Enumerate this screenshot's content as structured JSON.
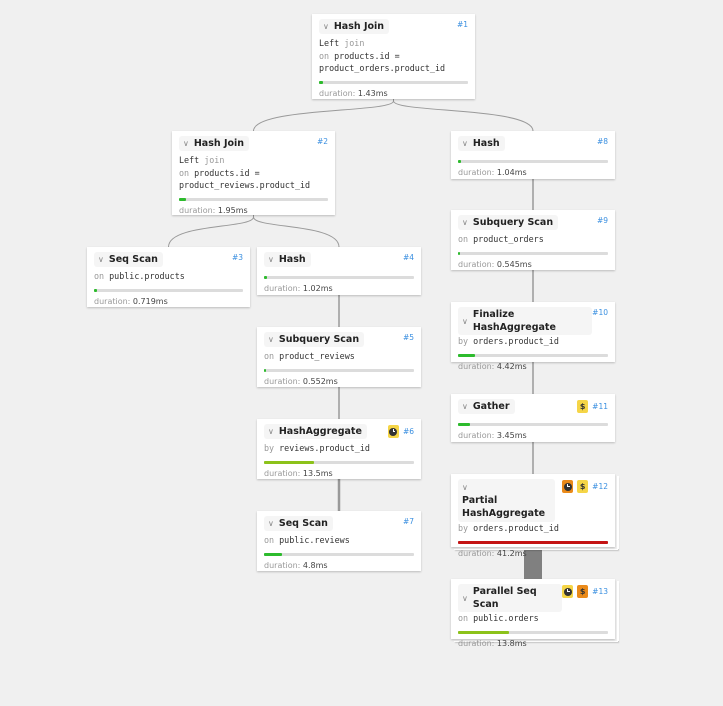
{
  "colors": {
    "background": "#f0f0f0",
    "id_text": "#3a8fe0",
    "bar_track": "#dcdcdc",
    "bar_low": "#2dbb2d",
    "bar_mid": "#8cc21a",
    "bar_high": "#c41414",
    "badge_yellow": "#f5d547",
    "badge_orange": "#ea8a1a",
    "edge": "#999999",
    "thick_edge": "#808080"
  },
  "labels": {
    "duration": "duration:"
  },
  "nodes": [
    {
      "id": "#1",
      "title": "Hash Join",
      "sub_lines": [
        [
          {
            "t": "Left ",
            "k": false
          },
          {
            "t": "join",
            "k": true
          }
        ],
        [
          {
            "t": "on ",
            "k": true
          },
          {
            "t": "products.id =",
            "k": false
          }
        ],
        [
          {
            "t": "product_orders.product_id",
            "k": false
          }
        ]
      ],
      "duration": "1.43ms",
      "progress": 0.03,
      "bar_color": "#2dbb2d",
      "badges": []
    },
    {
      "id": "#2",
      "title": "Hash Join",
      "sub_lines": [
        [
          {
            "t": "Left ",
            "k": false
          },
          {
            "t": "join",
            "k": true
          }
        ],
        [
          {
            "t": "on ",
            "k": true
          },
          {
            "t": "products.id =",
            "k": false
          }
        ],
        [
          {
            "t": "product_reviews.product_id",
            "k": false
          }
        ]
      ],
      "duration": "1.95ms",
      "progress": 0.05,
      "bar_color": "#2dbb2d",
      "badges": []
    },
    {
      "id": "#3",
      "title": "Seq Scan",
      "sub_lines": [
        [
          {
            "t": "on ",
            "k": true
          },
          {
            "t": "public.products",
            "k": false
          }
        ]
      ],
      "duration": "0.719ms",
      "progress": 0.017,
      "bar_color": "#2dbb2d",
      "badges": []
    },
    {
      "id": "#4",
      "title": "Hash",
      "sub_lines": [],
      "duration": "1.02ms",
      "progress": 0.02,
      "bar_color": "#2dbb2d",
      "badges": []
    },
    {
      "id": "#5",
      "title": "Subquery Scan",
      "sub_lines": [
        [
          {
            "t": "on ",
            "k": true
          },
          {
            "t": "product_reviews",
            "k": false
          }
        ]
      ],
      "duration": "0.552ms",
      "progress": 0.01,
      "bar_color": "#2dbb2d",
      "badges": []
    },
    {
      "id": "#6",
      "title": "HashAggregate",
      "sub_lines": [
        [
          {
            "t": "by ",
            "k": true
          },
          {
            "t": "reviews.product_id",
            "k": false
          }
        ]
      ],
      "duration": "13.5ms",
      "progress": 0.33,
      "bar_color": "#8cc21a",
      "badges": [
        {
          "type": "clock",
          "color": "#f5d547"
        }
      ]
    },
    {
      "id": "#7",
      "title": "Seq Scan",
      "sub_lines": [
        [
          {
            "t": "on ",
            "k": true
          },
          {
            "t": "public.reviews",
            "k": false
          }
        ]
      ],
      "duration": "4.8ms",
      "progress": 0.12,
      "bar_color": "#2dbb2d",
      "badges": []
    },
    {
      "id": "#8",
      "title": "Hash",
      "sub_lines": [],
      "duration": "1.04ms",
      "progress": 0.02,
      "bar_color": "#2dbb2d",
      "badges": []
    },
    {
      "id": "#9",
      "title": "Subquery Scan",
      "sub_lines": [
        [
          {
            "t": "on ",
            "k": true
          },
          {
            "t": "product_orders",
            "k": false
          }
        ]
      ],
      "duration": "0.545ms",
      "progress": 0.01,
      "bar_color": "#2dbb2d",
      "badges": []
    },
    {
      "id": "#10",
      "title": "Finalize HashAggregate",
      "sub_lines": [
        [
          {
            "t": "by ",
            "k": true
          },
          {
            "t": "orders.product_id",
            "k": false
          }
        ]
      ],
      "duration": "4.42ms",
      "progress": 0.11,
      "bar_color": "#2dbb2d",
      "badges": []
    },
    {
      "id": "#11",
      "title": "Gather",
      "sub_lines": [],
      "duration": "3.45ms",
      "progress": 0.08,
      "bar_color": "#2dbb2d",
      "badges": [
        {
          "type": "dollar",
          "color": "#f5d547"
        }
      ]
    },
    {
      "id": "#12",
      "title": "Partial HashAggregate",
      "title_wrap": true,
      "sub_lines": [
        [
          {
            "t": "by ",
            "k": true
          },
          {
            "t": "orders.product_id",
            "k": false
          }
        ]
      ],
      "duration": "41.2ms",
      "progress": 1.0,
      "bar_color": "#c41414",
      "badges": [
        {
          "type": "clock",
          "color": "#ea8a1a"
        },
        {
          "type": "dollar",
          "color": "#f5d547"
        }
      ],
      "stacked": true
    },
    {
      "id": "#13",
      "title": "Parallel Seq Scan",
      "sub_lines": [
        [
          {
            "t": "on ",
            "k": true
          },
          {
            "t": "public.orders",
            "k": false
          }
        ]
      ],
      "duration": "13.8ms",
      "progress": 0.34,
      "bar_color": "#8cc21a",
      "badges": [
        {
          "type": "clock",
          "color": "#f5d547"
        },
        {
          "type": "dollar",
          "color": "#ea8a1a"
        }
      ],
      "stacked": true
    }
  ],
  "edges": [
    {
      "from": "#1",
      "to": "#2",
      "weight": "thin"
    },
    {
      "from": "#1",
      "to": "#8",
      "weight": "thin"
    },
    {
      "from": "#2",
      "to": "#3",
      "weight": "thin"
    },
    {
      "from": "#2",
      "to": "#4",
      "weight": "thin"
    },
    {
      "from": "#4",
      "to": "#5",
      "weight": "thin"
    },
    {
      "from": "#5",
      "to": "#6",
      "weight": "thin"
    },
    {
      "from": "#6",
      "to": "#7",
      "weight": "medium"
    },
    {
      "from": "#8",
      "to": "#9",
      "weight": "thin"
    },
    {
      "from": "#9",
      "to": "#10",
      "weight": "thin"
    },
    {
      "from": "#10",
      "to": "#11",
      "weight": "thin"
    },
    {
      "from": "#11",
      "to": "#12",
      "weight": "thin"
    },
    {
      "from": "#12",
      "to": "#13",
      "weight": "thick"
    }
  ]
}
